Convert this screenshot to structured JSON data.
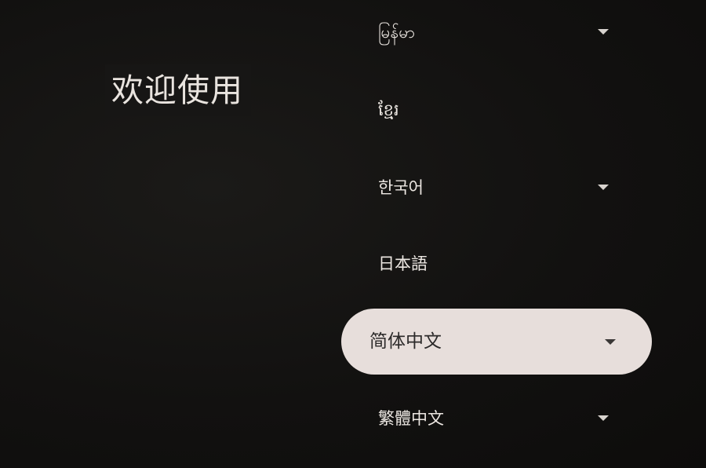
{
  "welcome": {
    "title": "欢迎使用"
  },
  "languages": [
    {
      "label": "မြန်မာ",
      "has_submenu": true,
      "selected": false
    },
    {
      "label": "ខ្មែរ",
      "has_submenu": false,
      "selected": false
    },
    {
      "label": "한국어",
      "has_submenu": true,
      "selected": false
    },
    {
      "label": "日本語",
      "has_submenu": false,
      "selected": false
    },
    {
      "label": "简体中文",
      "has_submenu": true,
      "selected": true
    },
    {
      "label": "繁體中文",
      "has_submenu": true,
      "selected": false
    }
  ],
  "icons": {
    "submenu": "chevron-down-icon"
  },
  "colors": {
    "background": "#121110",
    "text": "#ece7e2",
    "selected_background": "#e7dedb",
    "selected_text": "#2c2a2a"
  }
}
